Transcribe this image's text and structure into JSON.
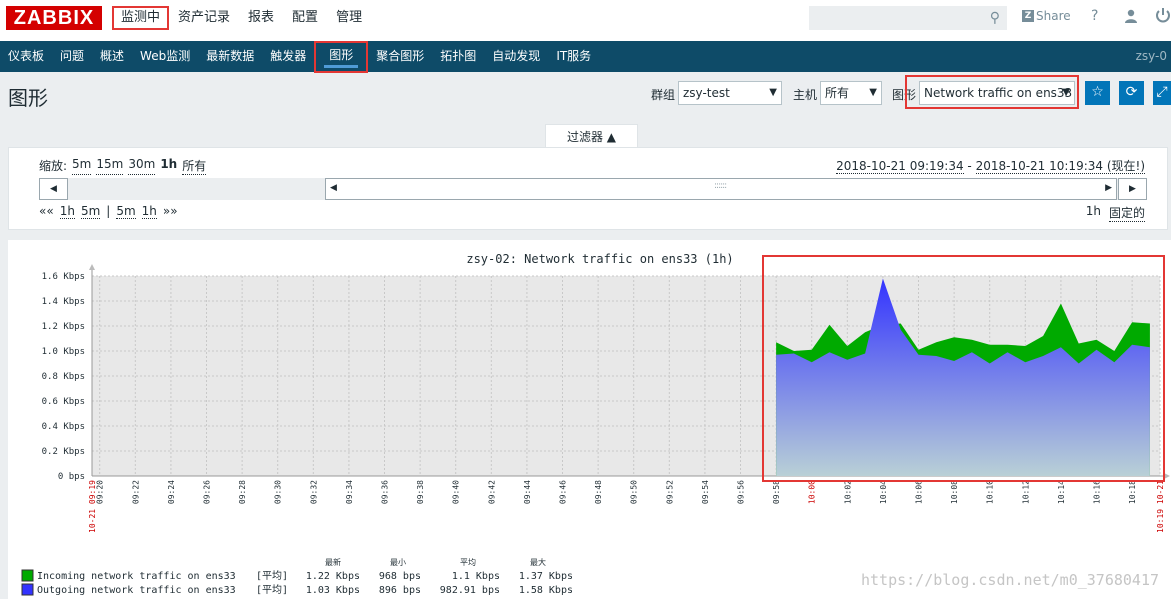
{
  "topbar": {
    "logo": "ZABBIX",
    "menu": [
      "监测中",
      "资产记录",
      "报表",
      "配置",
      "管理"
    ],
    "active_menu": 0,
    "search_placeholder": "",
    "share_label": "Share",
    "help_label": "?"
  },
  "submenu": {
    "items": [
      "仪表板",
      "问题",
      "概述",
      "Web监测",
      "最新数据",
      "触发器",
      "图形",
      "聚合图形",
      "拓扑图",
      "自动发现",
      "IT服务"
    ],
    "active_index": 6,
    "host_text": "zsy-0"
  },
  "header": {
    "title": "图形",
    "group_label": "群组",
    "group_value": "zsy-test",
    "host_label": "主机",
    "host_value": "所有",
    "graph_label": "图形",
    "graph_value": "Network traffic on ens33"
  },
  "filter": {
    "tab_label": "过滤器 ▲",
    "zoom_label": "缩放:",
    "zoom_options": [
      "5m",
      "15m",
      "30m",
      "1h",
      "所有"
    ],
    "zoom_active": "1h",
    "period_from": "2018-10-21 09:19:34",
    "period_sep": " - ",
    "period_to": "2018-10-21 10:19:34 (现在!)",
    "nav_left": "««",
    "nav_links": [
      "1h",
      "5m",
      "|",
      "5m",
      "1h"
    ],
    "nav_right": "»»",
    "duration": "1h",
    "fixed_label": "固定的"
  },
  "graph": {
    "title": "zsy-02: Network traffic on ens33 (1h)",
    "legend_headers": [
      "最新",
      "最小",
      "平均",
      "最大"
    ],
    "legend": [
      {
        "name": "Incoming network traffic on ens33",
        "func": "[平均]",
        "last": "1.22 Kbps",
        "min": "968 bps",
        "avg": "1.1 Kbps",
        "max": "1.37 Kbps",
        "color": "#00aa00"
      },
      {
        "name": "Outgoing network traffic on ens33",
        "func": "[平均]",
        "last": "1.03 Kbps",
        "min": "896 bps",
        "avg": "982.91 bps",
        "max": "1.58 Kbps",
        "color": "#3333ff"
      }
    ],
    "watermark": "https://blog.csdn.net/m0_37680417"
  },
  "chart_data": {
    "type": "area",
    "title": "zsy-02: Network traffic on ens33 (1h)",
    "y_ticks": [
      "0 bps",
      "0.2 Kbps",
      "0.4 Kbps",
      "0.6 Kbps",
      "0.8 Kbps",
      "1.0 Kbps",
      "1.2 Kbps",
      "1.4 Kbps",
      "1.6 Kbps"
    ],
    "ylim": [
      0,
      1.6
    ],
    "x_ticks": [
      "10-21 09:19",
      "09:20",
      "09:22",
      "09:24",
      "09:26",
      "09:28",
      "09:30",
      "09:32",
      "09:34",
      "09:36",
      "09:38",
      "09:40",
      "09:42",
      "09:44",
      "09:46",
      "09:48",
      "09:50",
      "09:52",
      "09:54",
      "09:56",
      "09:58",
      "10:00",
      "10:02",
      "10:04",
      "10:06",
      "10:08",
      "10:10",
      "10:12",
      "10:14",
      "10:16",
      "10:18",
      "10:19 10-21"
    ],
    "red_ticks": [
      "10-21 09:19",
      "10:00",
      "10:19 10-21"
    ],
    "series": [
      {
        "name": "Incoming network traffic on ens33",
        "color": "#00aa00",
        "x": [
          "09:58",
          "09:59",
          "10:00",
          "10:01",
          "10:02",
          "10:03",
          "10:04",
          "10:05",
          "10:06",
          "10:07",
          "10:08",
          "10:09",
          "10:10",
          "10:11",
          "10:12",
          "10:13",
          "10:14",
          "10:15",
          "10:16",
          "10:17",
          "10:18",
          "10:19"
        ],
        "values": [
          1.07,
          1.0,
          1.01,
          1.21,
          1.04,
          1.15,
          1.21,
          1.22,
          1.01,
          1.07,
          1.11,
          1.09,
          1.05,
          1.05,
          1.04,
          1.12,
          1.38,
          1.06,
          1.09,
          1.0,
          1.23,
          1.22
        ]
      },
      {
        "name": "Outgoing network traffic on ens33",
        "color": "#3333ff",
        "x": [
          "09:58",
          "09:59",
          "10:00",
          "10:01",
          "10:02",
          "10:03",
          "10:04",
          "10:05",
          "10:06",
          "10:07",
          "10:08",
          "10:09",
          "10:10",
          "10:11",
          "10:12",
          "10:13",
          "10:14",
          "10:15",
          "10:16",
          "10:17",
          "10:18",
          "10:19"
        ],
        "values": [
          0.97,
          0.98,
          0.91,
          0.99,
          0.93,
          0.98,
          1.58,
          1.17,
          0.97,
          0.96,
          0.92,
          0.99,
          0.9,
          0.99,
          0.91,
          0.96,
          1.03,
          0.9,
          1.01,
          0.91,
          1.05,
          1.03
        ]
      }
    ],
    "grid": true
  }
}
